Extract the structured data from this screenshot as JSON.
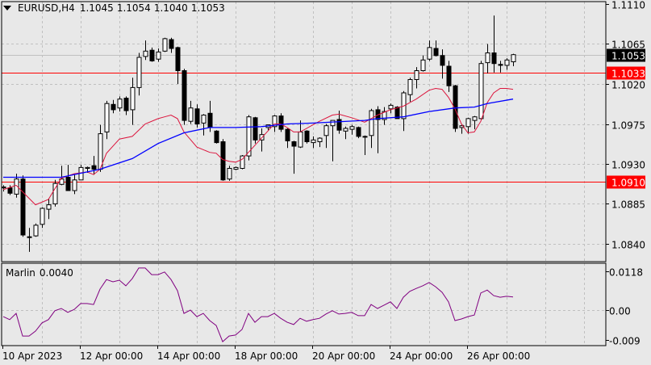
{
  "header": {
    "symbol": "EURUSD,H4",
    "open": "1.1045",
    "high": "1.1054",
    "low": "1.1040",
    "close": "1.1053"
  },
  "indicator_header": {
    "name": "Marlin",
    "value": "0.0040"
  },
  "price_labels": {
    "current": "1.1053",
    "level_upper": "1.1033",
    "level_lower": "1.0910"
  },
  "colors": {
    "background": "#e8e8e8",
    "grid": "#c0c0c0",
    "level": "#ff0000",
    "ma_fast": "#dc143c",
    "ma_slow": "#0000ff",
    "marlin": "#800080",
    "current_line": "#c0c0c0"
  },
  "chart_data": [
    {
      "type": "candlestick",
      "title": "EURUSD,H4",
      "ylim": [
        1.0827,
        1.1113
      ],
      "yticks": [
        "1.1110",
        "1.1065",
        "1.1020",
        "1.0975",
        "1.0930",
        "1.0885",
        "1.0840"
      ],
      "xticks": [
        {
          "index": 0,
          "label": "10 Apr 2023"
        },
        {
          "index": 12,
          "label": "12 Apr 00:00"
        },
        {
          "index": 24,
          "label": "14 Apr 00:00"
        },
        {
          "index": 36,
          "label": "18 Apr 00:00"
        },
        {
          "index": 48,
          "label": "20 Apr 00:00"
        },
        {
          "index": 60,
          "label": "24 Apr 00:00"
        },
        {
          "index": 72,
          "label": "26 Apr 00:00"
        }
      ],
      "horizontal_levels": [
        1.1033,
        1.091
      ],
      "current_price": 1.1053,
      "ohlc": [
        [
          1.0903,
          1.0906,
          1.0899,
          1.0904
        ],
        [
          1.0903,
          1.0906,
          1.0895,
          1.0897
        ],
        [
          1.0896,
          1.0919,
          1.0892,
          1.0913
        ],
        [
          1.0913,
          1.0917,
          1.0848,
          1.085
        ],
        [
          1.0848,
          1.0858,
          1.0831,
          1.0848
        ],
        [
          1.0849,
          1.0863,
          1.0848,
          1.0861
        ],
        [
          1.0862,
          1.0881,
          1.0858,
          1.088
        ],
        [
          1.0879,
          1.0891,
          1.0868,
          1.0884
        ],
        [
          1.0885,
          1.0912,
          1.0882,
          1.0908
        ],
        [
          1.0907,
          1.0928,
          1.0906,
          1.0913
        ],
        [
          1.0915,
          1.0929,
          1.09,
          1.09
        ],
        [
          1.09,
          1.0919,
          1.0896,
          1.0912
        ],
        [
          1.0912,
          1.0929,
          1.0912,
          1.0926
        ],
        [
          1.0925,
          1.0927,
          1.092,
          1.0926
        ],
        [
          1.0928,
          1.0939,
          1.0918,
          1.0924
        ],
        [
          1.0924,
          1.0974,
          1.0921,
          1.0964
        ],
        [
          1.0966,
          1.1001,
          1.0958,
          1.0998
        ],
        [
          1.0997,
          1.1002,
          1.0987,
          1.0991
        ],
        [
          1.0993,
          1.1006,
          1.0989,
          1.1003
        ],
        [
          1.1004,
          1.1006,
          1.0985,
          1.099
        ],
        [
          1.0991,
          1.1027,
          1.0974,
          1.1016
        ],
        [
          1.1016,
          1.1055,
          1.1007,
          1.105
        ],
        [
          1.1051,
          1.1069,
          1.1047,
          1.1057
        ],
        [
          1.1058,
          1.1061,
          1.1045,
          1.1046
        ],
        [
          1.1048,
          1.106,
          1.1045,
          1.1056
        ],
        [
          1.1057,
          1.1072,
          1.1056,
          1.1071
        ],
        [
          1.107,
          1.1072,
          1.1055,
          1.106
        ],
        [
          1.1061,
          1.1062,
          1.102,
          1.1035
        ],
        [
          1.1035,
          1.1037,
          1.0974,
          1.0979
        ],
        [
          1.0978,
          1.1001,
          1.0975,
          1.0993
        ],
        [
          1.0992,
          1.0997,
          1.0971,
          1.0975
        ],
        [
          1.0976,
          1.0986,
          1.0962,
          1.0985
        ],
        [
          1.0987,
          1.1001,
          1.0966,
          1.0971
        ],
        [
          1.0967,
          1.0968,
          1.0953,
          1.0954
        ],
        [
          1.0955,
          1.0958,
          1.0911,
          1.0912
        ],
        [
          1.0913,
          1.0928,
          1.0911,
          1.0925
        ],
        [
          1.0924,
          1.0927,
          1.0923,
          1.0926
        ],
        [
          1.0925,
          1.094,
          1.0924,
          1.0939
        ],
        [
          1.0939,
          1.0985,
          1.0934,
          1.0983
        ],
        [
          1.0982,
          1.0983,
          1.0953,
          1.0957
        ],
        [
          1.0957,
          1.097,
          1.0944,
          1.0963
        ],
        [
          1.0971,
          1.0974,
          1.0968,
          1.0974
        ],
        [
          1.0972,
          1.0985,
          1.0966,
          1.0984
        ],
        [
          1.0984,
          1.0987,
          1.0966,
          1.0969
        ],
        [
          1.0969,
          1.097,
          1.0948,
          1.0956
        ],
        [
          1.0955,
          1.0956,
          1.0919,
          1.095
        ],
        [
          1.0949,
          1.0979,
          1.0948,
          1.0966
        ],
        [
          1.0967,
          1.0968,
          1.0953,
          1.0955
        ],
        [
          1.0954,
          1.0961,
          1.0948,
          1.0957
        ],
        [
          1.0955,
          1.096,
          1.0949,
          1.0959
        ],
        [
          1.0962,
          1.0975,
          1.0948,
          1.0973
        ],
        [
          1.0973,
          1.0979,
          1.0933,
          1.0979
        ],
        [
          1.098,
          1.099,
          1.0964,
          1.0968
        ],
        [
          1.0967,
          1.0972,
          1.0958,
          1.097
        ],
        [
          1.0969,
          1.0974,
          1.0963,
          1.0972
        ],
        [
          1.0971,
          1.0972,
          1.0959,
          1.0961
        ],
        [
          1.0961,
          1.0962,
          1.094,
          1.0961
        ],
        [
          1.0962,
          1.0992,
          1.0948,
          1.099
        ],
        [
          1.0991,
          1.0995,
          1.0942,
          1.098
        ],
        [
          1.098,
          1.0994,
          1.0974,
          1.0989
        ],
        [
          1.0992,
          1.0998,
          1.0987,
          1.0996
        ],
        [
          1.0994,
          1.0995,
          1.0981,
          1.0981
        ],
        [
          1.0981,
          1.1012,
          1.0967,
          1.101
        ],
        [
          1.1008,
          1.1027,
          1.1,
          1.1025
        ],
        [
          1.1025,
          1.1039,
          1.1015,
          1.1035
        ],
        [
          1.1035,
          1.1052,
          1.1034,
          1.1047
        ],
        [
          1.1048,
          1.1069,
          1.1046,
          1.1061
        ],
        [
          1.106,
          1.1069,
          1.1051,
          1.1052
        ],
        [
          1.1052,
          1.1059,
          1.1026,
          1.1041
        ],
        [
          1.104,
          1.1046,
          1.1011,
          1.1018
        ],
        [
          1.1018,
          1.1019,
          1.0966,
          1.097
        ],
        [
          1.0971,
          1.0975,
          1.0964,
          1.0973
        ],
        [
          1.0972,
          1.0982,
          1.0964,
          1.0981
        ],
        [
          1.0979,
          1.0984,
          1.0969,
          1.0983
        ],
        [
          1.0981,
          1.1046,
          1.098,
          1.1043
        ],
        [
          1.1044,
          1.1065,
          1.1032,
          1.1055
        ],
        [
          1.1055,
          1.1097,
          1.1033,
          1.1043
        ],
        [
          1.1042,
          1.1046,
          1.1033,
          1.1041
        ],
        [
          1.1041,
          1.1049,
          1.1036,
          1.1047
        ],
        [
          1.1045,
          1.1054,
          1.104,
          1.1053
        ]
      ],
      "ma_fast": [
        [
          0,
          1.0901
        ],
        [
          2,
          1.0906
        ],
        [
          5,
          1.0884
        ],
        [
          7,
          1.089
        ],
        [
          9,
          1.0914
        ],
        [
          11,
          1.0919
        ],
        [
          13,
          1.0921
        ],
        [
          14,
          1.0918
        ],
        [
          15,
          1.0924
        ],
        [
          16,
          1.0942
        ],
        [
          18,
          1.0958
        ],
        [
          20,
          1.0961
        ],
        [
          22,
          1.0975
        ],
        [
          24,
          1.0981
        ],
        [
          25,
          1.0983
        ],
        [
          26,
          1.0985
        ],
        [
          27,
          1.0981
        ],
        [
          28,
          1.0966
        ],
        [
          30,
          1.0949
        ],
        [
          32,
          1.0943
        ],
        [
          33,
          1.0942
        ],
        [
          34,
          1.0935
        ],
        [
          35,
          1.0933
        ],
        [
          36,
          1.0932
        ],
        [
          37,
          1.0935
        ],
        [
          39,
          1.0951
        ],
        [
          41,
          1.0967
        ],
        [
          42,
          1.0975
        ],
        [
          43,
          1.0975
        ],
        [
          44,
          1.0971
        ],
        [
          45,
          1.0966
        ],
        [
          46,
          1.0966
        ],
        [
          48,
          1.0974
        ],
        [
          49,
          1.0978
        ],
        [
          51,
          1.0985
        ],
        [
          52,
          1.0986
        ],
        [
          54,
          1.0982
        ],
        [
          56,
          1.0977
        ],
        [
          58,
          1.0985
        ],
        [
          60,
          1.0991
        ],
        [
          62,
          1.0995
        ],
        [
          64,
          1.1003
        ],
        [
          66,
          1.1013
        ],
        [
          67,
          1.1015
        ],
        [
          68,
          1.1014
        ],
        [
          69,
          1.1005
        ],
        [
          70,
          1.0992
        ],
        [
          71,
          1.0975
        ],
        [
          72,
          1.0965
        ],
        [
          73,
          1.0966
        ],
        [
          74,
          1.0978
        ],
        [
          75,
          1.0999
        ],
        [
          76,
          1.101
        ],
        [
          77,
          1.1015
        ],
        [
          78,
          1.1015
        ],
        [
          79,
          1.1014
        ]
      ],
      "ma_slow": [
        [
          0,
          1.0915
        ],
        [
          9,
          1.0915
        ],
        [
          15,
          1.0924
        ],
        [
          20,
          1.0936
        ],
        [
          24,
          1.0953
        ],
        [
          28,
          1.0965
        ],
        [
          32,
          1.0971
        ],
        [
          36,
          1.0971
        ],
        [
          40,
          1.0972
        ],
        [
          44,
          1.0975
        ],
        [
          48,
          1.0976
        ],
        [
          56,
          1.0979
        ],
        [
          58,
          1.0981
        ],
        [
          62,
          1.0983
        ],
        [
          66,
          1.0989
        ],
        [
          70,
          1.0993
        ],
        [
          73,
          1.0994
        ],
        [
          75,
          1.0998
        ],
        [
          79,
          1.1003
        ]
      ]
    },
    {
      "type": "line",
      "title": "Marlin",
      "ylim": [
        -0.0107,
        0.0143
      ],
      "yticks": [
        "0.0118",
        "0.00",
        "-0.009"
      ],
      "values": [
        -0.002,
        -0.0029,
        -0.001,
        -0.0079,
        -0.0079,
        -0.0064,
        -0.0039,
        -0.0029,
        -0.0002,
        0.0005,
        -0.0007,
        0.0002,
        0.002,
        0.002,
        0.0017,
        0.0064,
        0.0093,
        0.0086,
        0.0091,
        0.0074,
        0.0096,
        0.0128,
        0.0128,
        0.0108,
        0.0108,
        0.0116,
        0.0093,
        0.0059,
        -0.001,
        0.0,
        -0.002,
        -0.001,
        -0.0032,
        -0.0047,
        -0.0096,
        -0.0079,
        -0.0076,
        -0.0059,
        -0.001,
        -0.0037,
        -0.002,
        -0.002,
        -0.001,
        -0.0025,
        -0.0037,
        -0.0044,
        -0.0025,
        -0.0034,
        -0.0029,
        -0.0025,
        -0.0012,
        -0.0002,
        -0.0012,
        -0.001,
        -0.0007,
        -0.0017,
        -0.0017,
        0.0017,
        0.0005,
        0.0015,
        0.0025,
        0.0005,
        0.0039,
        0.0057,
        0.0066,
        0.0074,
        0.0084,
        0.0071,
        0.0054,
        0.0025,
        -0.0032,
        -0.0027,
        -0.002,
        -0.0015,
        0.0052,
        0.0061,
        0.0044,
        0.0039,
        0.0042,
        0.004
      ]
    }
  ]
}
